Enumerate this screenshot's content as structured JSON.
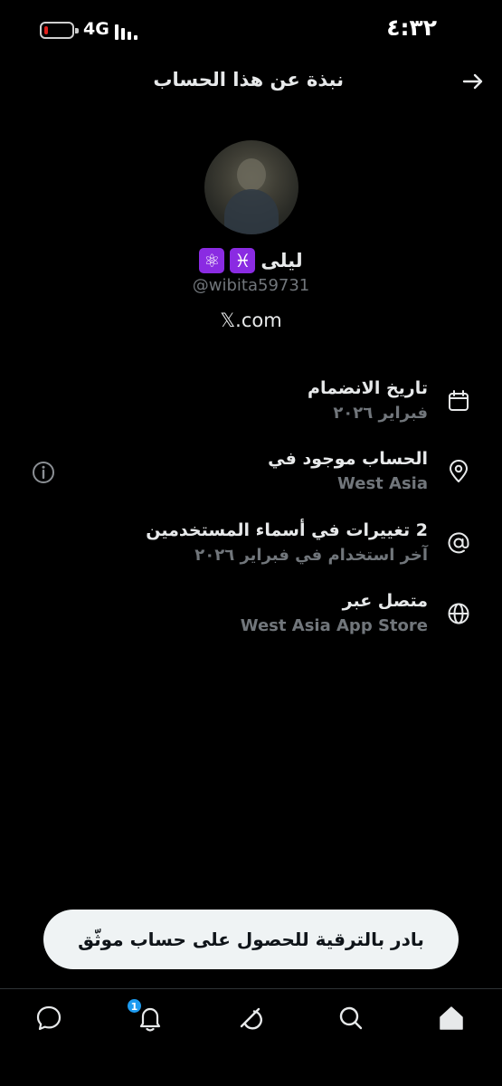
{
  "status_bar": {
    "time": "٤:٣٢",
    "network": "4G",
    "battery_level": 0.15,
    "battery_color": "#e0201b"
  },
  "header": {
    "title": "نبذة عن هذا الحساب",
    "back_icon": "arrow-right-icon"
  },
  "profile": {
    "display_name": "ليلى",
    "badges": [
      "♓",
      "⚛"
    ],
    "badge_color": "#8a2be2",
    "handle": "@wibita59731",
    "site": "𝕏.com"
  },
  "info": [
    {
      "icon": "calendar-icon",
      "title": "تاريخ الانضمام",
      "subtitle": "فبراير ٢٠٢٦"
    },
    {
      "icon": "location-pin-icon",
      "title": "الحساب موجود في",
      "subtitle": "West Asia",
      "extra_icon": "info-icon"
    },
    {
      "icon": "at-sign-icon",
      "title": "2 تغييرات في أسماء المستخدمين",
      "subtitle": "آخر استخدام في فبراير ٢٠٢٦"
    },
    {
      "icon": "globe-icon",
      "title": "متصل عبر",
      "subtitle": "West Asia App Store"
    }
  ],
  "upgrade": {
    "label": "بادر بالترقية للحصول على حساب موثّق"
  },
  "nav": {
    "items": [
      "home-icon",
      "search-icon",
      "grok-icon",
      "bell-icon",
      "messages-icon"
    ],
    "notification_count": "1",
    "badge_color": "#1d9bf0"
  }
}
